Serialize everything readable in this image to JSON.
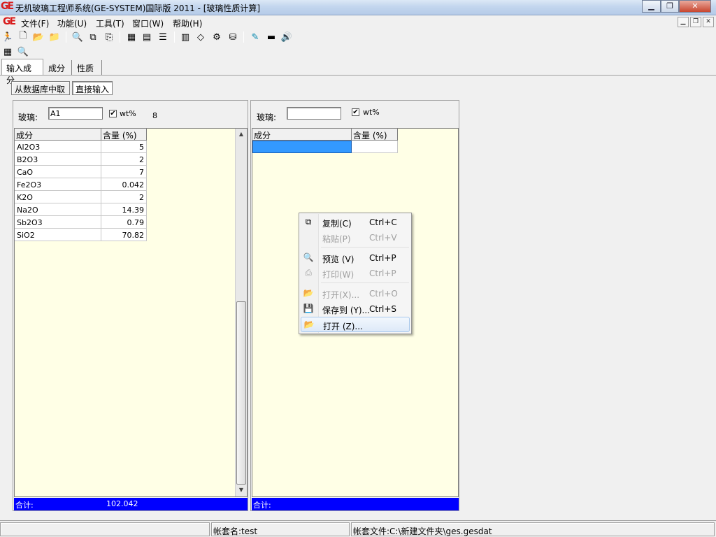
{
  "window": {
    "title": "无机玻璃工程师系统(GE-SYSTEM)国际版 2011 - [玻璃性质计算]",
    "logo": "GE",
    "minimize_icon": "minimize-icon",
    "maximize_icon": "restore-icon",
    "close_icon": "close-icon"
  },
  "menu": {
    "logo": "GE",
    "items": [
      "文件(F)",
      "功能(U)",
      "工具(T)",
      "窗口(W)",
      "帮助(H)"
    ]
  },
  "toolbar": {
    "row1_icons": [
      "run-icon",
      "new-file-icon",
      "open-folder-icon",
      "folder-icon",
      "database-search-icon",
      "database-copy-icon",
      "database-export-icon",
      "table-icon",
      "table-grid-icon",
      "stack-icon",
      "calculator-icon",
      "eraser-icon",
      "settings-doc-icon",
      "database-icon",
      "edit-icon",
      "ruler-icon",
      "speaker-icon"
    ],
    "row2_icons": [
      "table-view-icon",
      "preview-icon"
    ]
  },
  "tabs": [
    "输入成分",
    "成分",
    "性质"
  ],
  "source_buttons": {
    "from_db": "从数据库中取",
    "direct_input": "直接输入"
  },
  "left_panel": {
    "glass_label": "玻璃:",
    "glass_value": "A1",
    "wt_checked": true,
    "wt_label": "wt%",
    "count": "8",
    "columns": [
      "成分",
      "含量 (%)"
    ],
    "rows": [
      {
        "name": "Al2O3",
        "value": "5"
      },
      {
        "name": "B2O3",
        "value": "2"
      },
      {
        "name": "CaO",
        "value": "7"
      },
      {
        "name": "Fe2O3",
        "value": "0.042"
      },
      {
        "name": "K2O",
        "value": "2"
      },
      {
        "name": "Na2O",
        "value": "14.39"
      },
      {
        "name": "Sb2O3",
        "value": "0.79"
      },
      {
        "name": "SiO2",
        "value": "70.82"
      }
    ],
    "total_label": "合计:",
    "total_value": "102.042"
  },
  "right_panel": {
    "glass_label": "玻璃:",
    "glass_value": "",
    "wt_checked": true,
    "wt_label": "wt%",
    "columns": [
      "成分",
      "含量 (%)"
    ],
    "total_label": "合计:"
  },
  "context_menu": {
    "items": [
      {
        "label": "复制(C)",
        "shortcut": "Ctrl+C",
        "icon": "copy-icon",
        "disabled": false
      },
      {
        "label": "粘贴(P)",
        "shortcut": "Ctrl+V",
        "icon": "paste-icon",
        "disabled": true
      },
      {
        "label": "预览 (V)",
        "shortcut": "Ctrl+P",
        "icon": "preview-icon",
        "disabled": false
      },
      {
        "label": "打印(W)",
        "shortcut": "Ctrl+P",
        "icon": "printer-icon",
        "disabled": true
      },
      {
        "label": "打开(X)...",
        "shortcut": "Ctrl+O",
        "icon": "open-folder-icon",
        "disabled": true
      },
      {
        "label": "保存到 (Y)...",
        "shortcut": "Ctrl+S",
        "icon": "save-icon",
        "disabled": false
      },
      {
        "label": "打开 (Z)...",
        "shortcut": "",
        "icon": "open-folder-icon",
        "disabled": false
      }
    ]
  },
  "status": {
    "account": "帐套名:test",
    "account_file": "帐套文件:C:\\新建文件夹\\ges.gesdat"
  },
  "colors": {
    "grid_bg": "#ffffe6",
    "total_bar": "#0000ff",
    "selection": "#3399ff"
  }
}
